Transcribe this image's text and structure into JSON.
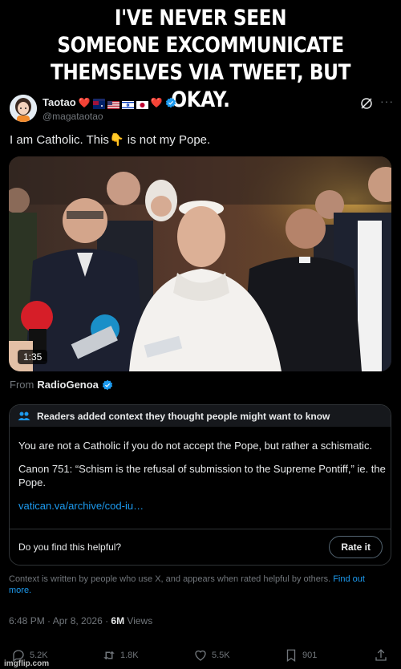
{
  "caption": {
    "line1": "I'VE NEVER SEEN",
    "line2": "SOMEONE EXCOMMUNICATE",
    "line3": "THEMSELVES VIA TWEET, BUT OKAY."
  },
  "author": {
    "name": "Taotao",
    "handle": "@magataotao",
    "heart": "❤️",
    "verified_color": "#1d9bf0"
  },
  "tweet": {
    "text_before": "I am Catholic. This",
    "emoji": "👇",
    "text_after": " is not my Pope."
  },
  "video": {
    "duration": "1:35"
  },
  "source": {
    "prefix": "From",
    "name": "RadioGenoa"
  },
  "community_note": {
    "header": "Readers added context they thought people might want to know",
    "paragraph1": "You are not a Catholic if you do not accept the Pope, but rather a schismatic.",
    "paragraph2": "Canon 751: “Schism is the refusal of submission to the Supreme Pontiff,” ie. the Pope.",
    "link": "vatican.va/archive/cod-iu…",
    "helpful_question": "Do you find this helpful?",
    "rate_label": "Rate it",
    "footer": "Context is written by people who use X, and appears when rated helpful by others.",
    "find_out_more": "Find out more."
  },
  "meta": {
    "time_date": "6:48 PM · Apr 8, 2026 · ",
    "views_count": "6M",
    "views_label": " Views"
  },
  "actions": {
    "replies": "5.2K",
    "reposts": "1.8K",
    "likes": "5.5K",
    "bookmarks": "901"
  },
  "watermark": "imgflip.com",
  "colors": {
    "accent": "#1d9bf0",
    "heart": "#f91880",
    "muted": "#71767b"
  }
}
